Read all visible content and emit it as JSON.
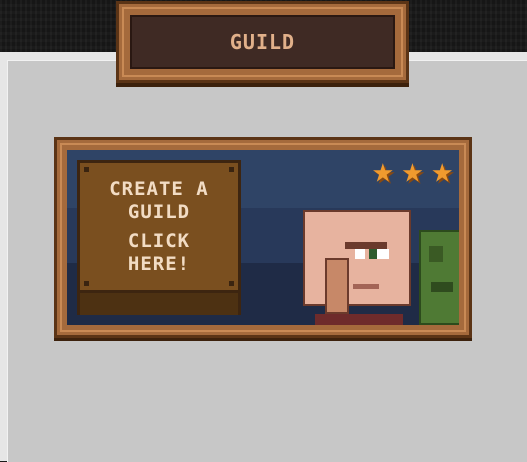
{
  "header": {
    "title": "GUILD"
  },
  "guild_card": {
    "sign_lines": [
      "CREATE A",
      "GUILD",
      "CLICK",
      "HERE!"
    ],
    "star_icons": [
      "star-icon",
      "star-icon",
      "star-icon"
    ],
    "colors": {
      "star": "#f09a2e",
      "frame": "#a56a3c",
      "sky": "#2f4466",
      "sign": "#7a4f1f"
    }
  }
}
